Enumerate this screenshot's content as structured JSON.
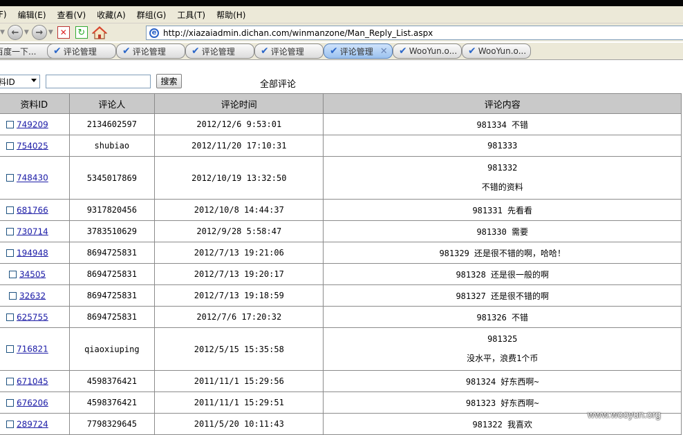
{
  "title": "",
  "menu": [
    "F)",
    "编辑(E)",
    "查看(V)",
    "收藏(A)",
    "群组(G)",
    "工具(T)",
    "帮助(H)"
  ],
  "address": "http://xiazaiadmin.dichan.com/winmanzone/Man_Reply_List.aspx",
  "tabs": [
    {
      "label": "百度一下...",
      "check": false,
      "active": false
    },
    {
      "label": "评论管理",
      "check": true,
      "active": false
    },
    {
      "label": "评论管理",
      "check": true,
      "active": false
    },
    {
      "label": "评论管理",
      "check": true,
      "active": false
    },
    {
      "label": "评论管理",
      "check": true,
      "active": false
    },
    {
      "label": "评论管理",
      "check": true,
      "active": true
    },
    {
      "label": "WooYun.o...",
      "check": true,
      "active": false
    },
    {
      "label": "WooYun.o...",
      "check": true,
      "active": false
    }
  ],
  "search": {
    "select_value": "料ID",
    "button_label": "搜索",
    "heading": "全部评论"
  },
  "table": {
    "headers": [
      "资料ID",
      "评论人",
      "评论时间",
      "评论内容"
    ],
    "rows": [
      {
        "id": "749209",
        "user": "2134602597",
        "time": "2012/12/6 9:53:01",
        "content": "981334 不错",
        "content2": ""
      },
      {
        "id": "754025",
        "user": "shubiao",
        "time": "2012/11/20 17:10:31",
        "content": "981333",
        "content2": ""
      },
      {
        "id": "748430",
        "user": "5345017869",
        "time": "2012/10/19 13:32:50",
        "content": "981332",
        "content2": "不错的资料"
      },
      {
        "id": "681766",
        "user": "9317820456",
        "time": "2012/10/8 14:44:37",
        "content": "981331 先看看",
        "content2": ""
      },
      {
        "id": "730714",
        "user": "3783510629",
        "time": "2012/9/28 5:58:47",
        "content": "981330 需要",
        "content2": ""
      },
      {
        "id": "194948",
        "user": "8694725831",
        "time": "2012/7/13 19:21:06",
        "content": "981329 还是很不错的啊，哈哈！",
        "content2": ""
      },
      {
        "id": "34505",
        "user": "8694725831",
        "time": "2012/7/13 19:20:17",
        "content": "981328 还是很一般的啊",
        "content2": ""
      },
      {
        "id": "32632",
        "user": "8694725831",
        "time": "2012/7/13 19:18:59",
        "content": "981327 还是很不错的啊",
        "content2": ""
      },
      {
        "id": "625755",
        "user": "8694725831",
        "time": "2012/7/6 17:20:32",
        "content": "981326 不错",
        "content2": ""
      },
      {
        "id": "716821",
        "user": "qiaoxiuping",
        "time": "2012/5/15 15:35:58",
        "content": "981325",
        "content2": "没水平，浪费1个币"
      },
      {
        "id": "671045",
        "user": "4598376421",
        "time": "2011/11/1 15:29:56",
        "content": "981324 好东西啊~",
        "content2": ""
      },
      {
        "id": "676206",
        "user": "4598376421",
        "time": "2011/11/1 15:29:51",
        "content": "981323 好东西啊~",
        "content2": ""
      },
      {
        "id": "289724",
        "user": "7798329645",
        "time": "2011/5/20 10:11:43",
        "content": "981322 我喜欢",
        "content2": ""
      }
    ]
  },
  "watermark": "www.wooyun.org"
}
